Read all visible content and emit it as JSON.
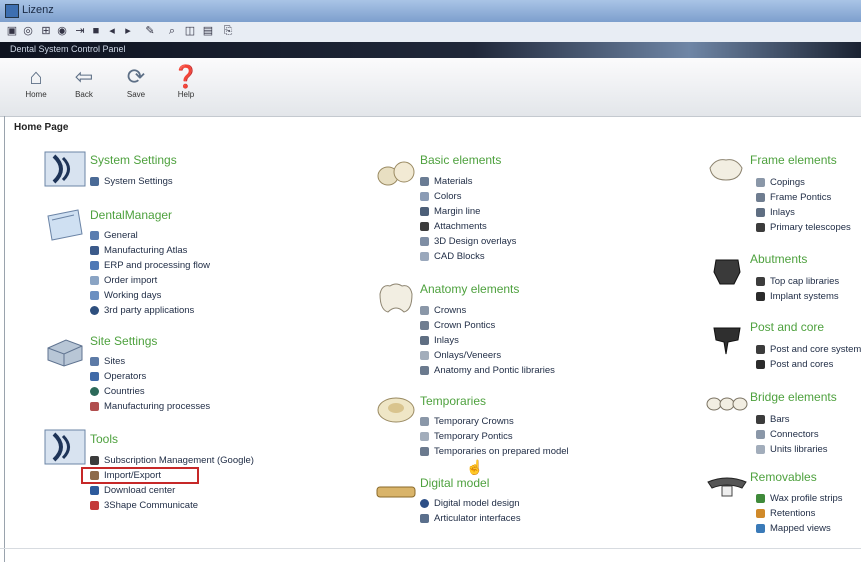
{
  "window": {
    "title": "Lizenz"
  },
  "pathbar": {
    "path": "Dental System Control Panel"
  },
  "toolbar": [
    {
      "label": "Home",
      "icon": "home-icon"
    },
    {
      "label": "Back",
      "icon": "back-arrow-icon"
    },
    {
      "label": "Save",
      "icon": "save-icon"
    },
    {
      "label": "Help",
      "icon": "help-icon"
    }
  ],
  "page_heading": "Home Page",
  "sections": [
    {
      "title": "System Settings",
      "icon": "system-settings-icon",
      "items": [
        "System Settings"
      ]
    },
    {
      "title": "DentalManager",
      "icon": "dental-manager-icon",
      "items": [
        "General",
        "Manufacturing Atlas",
        "ERP and processing flow",
        "Order import",
        "Working days",
        "3rd party applications"
      ]
    },
    {
      "title": "Site Settings",
      "icon": "site-settings-icon",
      "items": [
        "Sites",
        "Operators",
        "Countries",
        "Manufacturing processes"
      ]
    },
    {
      "title": "Tools",
      "icon": "tools-icon",
      "items": [
        "Subscription Management (Google)",
        "Import/Export",
        "Download center",
        "3Shape Communicate"
      ]
    },
    {
      "title": "Basic elements",
      "icon": "basic-elements-icon",
      "items": [
        "Materials",
        "Colors",
        "Margin line",
        "Attachments",
        "3D Design overlays",
        "CAD Blocks"
      ]
    },
    {
      "title": "Anatomy elements",
      "icon": "anatomy-elements-icon",
      "items": [
        "Crowns",
        "Crown Pontics",
        "Inlays",
        "Onlays/Veneers",
        "Anatomy and Pontic libraries"
      ]
    },
    {
      "title": "Temporaries",
      "icon": "temporaries-icon",
      "items": [
        "Temporary Crowns",
        "Temporary Pontics",
        "Temporaries on prepared model"
      ]
    },
    {
      "title": "Digital model",
      "icon": "digital-model-icon",
      "items": [
        "Digital model design",
        "Articulator interfaces"
      ]
    },
    {
      "title": "Frame elements",
      "icon": "frame-elements-icon",
      "items": [
        "Copings",
        "Frame Pontics",
        "Inlays",
        "Primary telescopes"
      ]
    },
    {
      "title": "Abutments",
      "icon": "abutments-icon",
      "items": [
        "Top cap libraries",
        "Implant systems"
      ]
    },
    {
      "title": "Post and core",
      "icon": "post-and-core-icon",
      "items": [
        "Post and core system",
        "Post and cores"
      ]
    },
    {
      "title": "Bridge elements",
      "icon": "bridge-elements-icon",
      "items": [
        "Bars",
        "Connectors",
        "Units libraries"
      ]
    },
    {
      "title": "Removables",
      "icon": "removables-icon",
      "items": [
        "Wax profile strips",
        "Retentions",
        "Mapped views"
      ]
    }
  ],
  "colors": {
    "section_title": "#4ea13e",
    "highlight": "#c62828"
  }
}
